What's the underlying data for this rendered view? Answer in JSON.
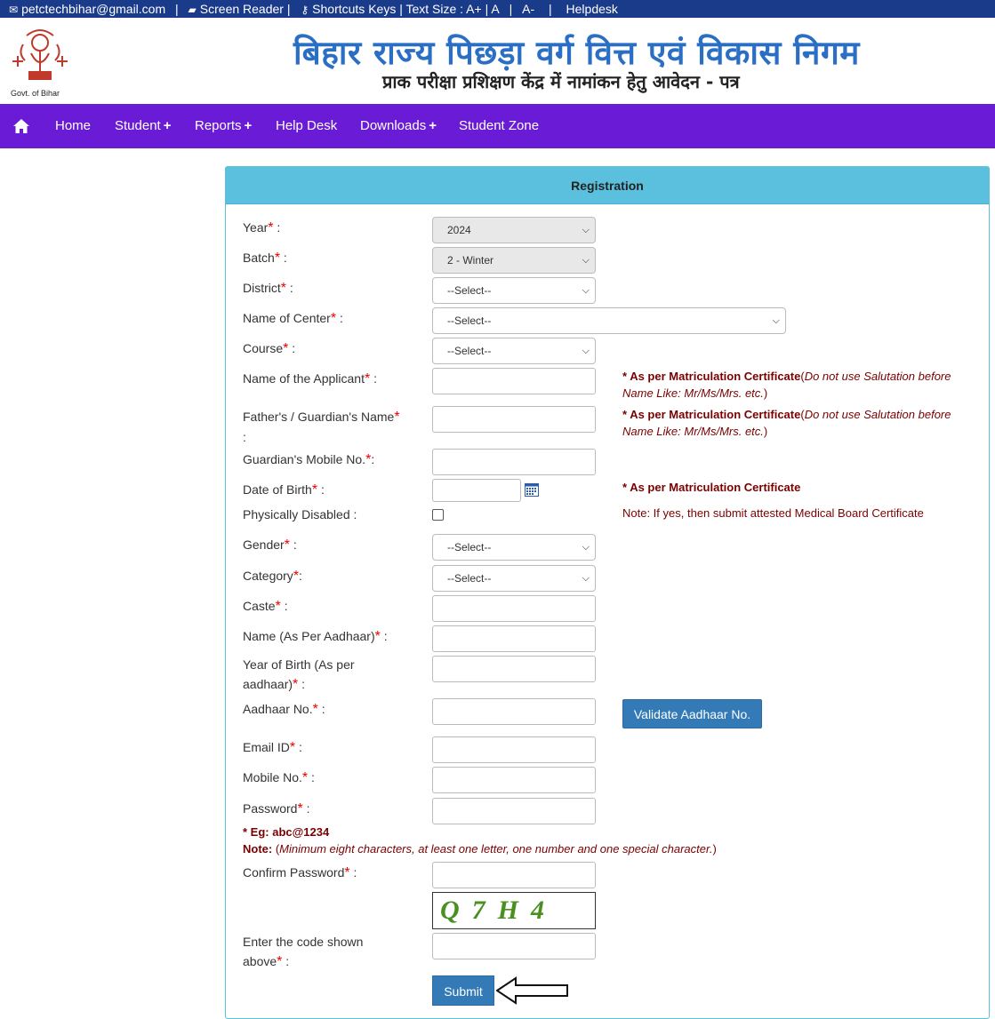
{
  "topbar": {
    "email": "petctechbihar@gmail.com",
    "screen_reader": "Screen Reader |",
    "shortcuts": "Shortcuts Keys | Text Size : A+ | A",
    "text_small": "A-",
    "helpdesk": "Helpdesk"
  },
  "header": {
    "emblem_caption": "Govt. of Bihar",
    "title": "बिहार राज्य पिछड़ा वर्ग वित्त एवं विकास निगम",
    "subtitle": "प्राक परीक्षा प्रशिक्षण केंद्र में नामांकन हेतु आवेदन - पत्र"
  },
  "nav": {
    "home": "Home",
    "student": "Student",
    "reports": "Reports",
    "helpdesk": "Help Desk",
    "downloads": "Downloads",
    "student_zone": "Student Zone",
    "plus": "+"
  },
  "form": {
    "heading": "Registration",
    "star": "*",
    "year": {
      "label": "Year",
      "suffix": " :",
      "value": "2024"
    },
    "batch": {
      "label": "Batch",
      "suffix": " :",
      "value": "2 - Winter"
    },
    "district": {
      "label": "District",
      "suffix": " :",
      "value": "--Select--"
    },
    "center": {
      "label": "Name of Center",
      "suffix": " :",
      "value": "--Select--"
    },
    "course": {
      "label": "Course",
      "suffix": " :",
      "value": "--Select--"
    },
    "applicant": {
      "label": "Name of the Applicant",
      "suffix": " :"
    },
    "guardian": {
      "label": "Father's / Guardian's Name",
      "suffix": ":"
    },
    "guardian_mobile": {
      "label": "Guardian's Mobile No.",
      "suffix": ":"
    },
    "dob": {
      "label": "Date of Birth",
      "suffix": " :"
    },
    "disabled": {
      "label": "Physically Disabled :"
    },
    "gender": {
      "label": "Gender",
      "suffix": " :",
      "value": "--Select--"
    },
    "category": {
      "label": "Category",
      "suffix": ":",
      "value": "--Select--"
    },
    "caste": {
      "label": "Caste",
      "suffix": " :"
    },
    "aadhaar_name": {
      "label": "Name (As Per Aadhaar)",
      "suffix": " :"
    },
    "aadhaar_yob": {
      "label_1": "Year of Birth (As per",
      "label_2": "aadhaar)",
      "suffix": " :"
    },
    "aadhaar_no": {
      "label": "Aadhaar No.",
      "suffix": " :"
    },
    "email": {
      "label": "Email ID",
      "suffix": " :"
    },
    "mobile": {
      "label": "Mobile No.",
      "suffix": " :"
    },
    "password": {
      "label": "Password",
      "suffix": " :"
    },
    "password_eg": "* Eg: abc@1234",
    "password_note_label": "Note:",
    "password_note_open": " (",
    "password_note": "Minimum eight characters, at least one letter, one number and one special character.",
    "password_note_close": ")",
    "confirm_password": {
      "label": "Confirm Password",
      "suffix": " :"
    },
    "captcha_code": "Q7H4",
    "captcha_label": {
      "label_1": "Enter the code shown",
      "label_2": "above",
      "suffix": " :"
    },
    "validate_button": "Validate Aadhaar No.",
    "submit_button": "Submit"
  },
  "notes": {
    "matric_bold": "* As per Matriculation Certificate",
    "matric_italic": "Do not use Salutation before Name Like: Mr/Ms/Mrs. etc.",
    "open": "(",
    "close": ")",
    "dob_note": "* As per Matriculation Certificate",
    "disabled_note": "Note: If yes, then submit attested Medical Board Certificate"
  },
  "colors": {
    "nav": "#6a1bd6",
    "topbar": "#1a3a8a",
    "panel_head": "#5bc0de",
    "button": "#337ab7",
    "note": "#7a0000"
  }
}
